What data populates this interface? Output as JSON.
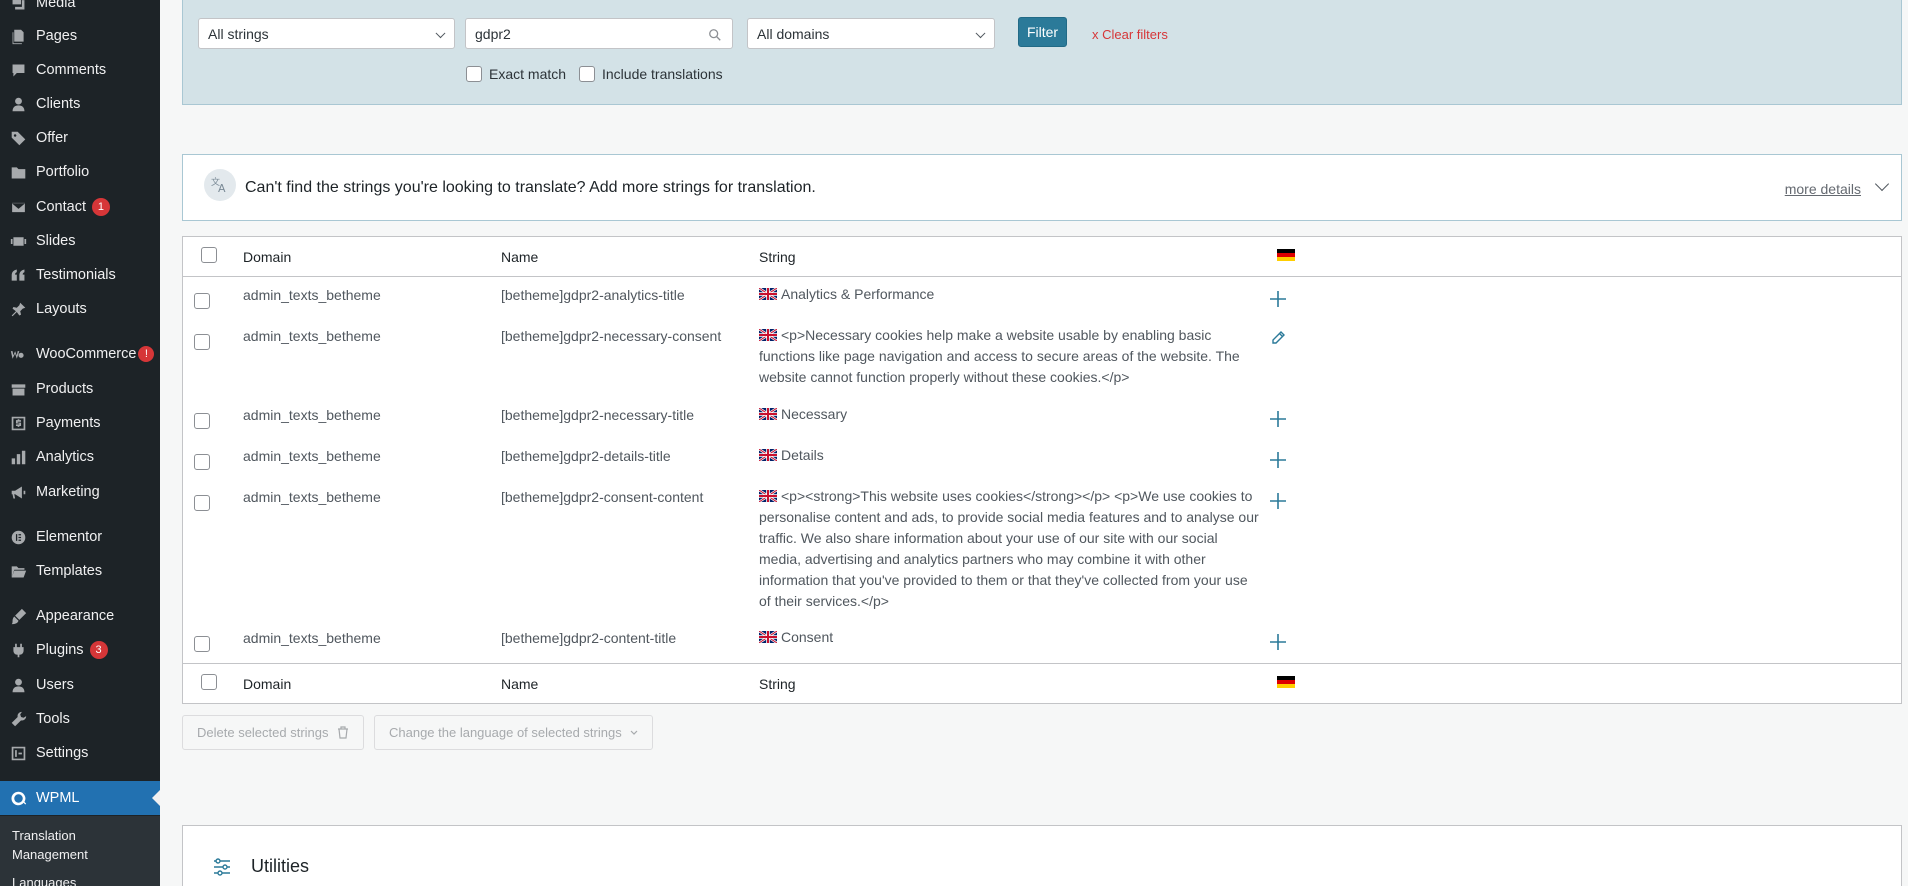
{
  "sidebar": {
    "items": [
      {
        "label": "Media",
        "icon": "media-icon"
      },
      {
        "label": "Pages",
        "icon": "pages-icon"
      },
      {
        "label": "Comments",
        "icon": "comments-icon"
      },
      {
        "label": "Clients",
        "icon": "clients-icon"
      },
      {
        "label": "Offer",
        "icon": "tag-icon"
      },
      {
        "label": "Portfolio",
        "icon": "folder-icon"
      },
      {
        "label": "Contact",
        "icon": "mail-icon",
        "badge": "1"
      },
      {
        "label": "Slides",
        "icon": "slides-icon"
      },
      {
        "label": "Testimonials",
        "icon": "quote-icon"
      },
      {
        "label": "Layouts",
        "icon": "pin-icon"
      },
      {
        "label": "WooCommerce",
        "icon": "woocommerce-icon",
        "badge": "!"
      },
      {
        "label": "Products",
        "icon": "archive-icon"
      },
      {
        "label": "Payments",
        "icon": "dollar-icon"
      },
      {
        "label": "Analytics",
        "icon": "bar-chart-icon"
      },
      {
        "label": "Marketing",
        "icon": "megaphone-icon"
      },
      {
        "label": "Elementor",
        "icon": "elementor-icon"
      },
      {
        "label": "Templates",
        "icon": "folder-open-icon"
      },
      {
        "label": "Appearance",
        "icon": "brush-icon"
      },
      {
        "label": "Plugins",
        "icon": "plug-icon",
        "badge": "3"
      },
      {
        "label": "Users",
        "icon": "users-icon"
      },
      {
        "label": "Tools",
        "icon": "wrench-icon"
      },
      {
        "label": "Settings",
        "icon": "settings-icon"
      },
      {
        "label": "WPML",
        "icon": "wpml-icon",
        "active": true
      }
    ],
    "submenu": {
      "translation_management": "Translation\nManagement",
      "languages": "Languages"
    }
  },
  "filters": {
    "type_select": "All strings",
    "search_value": "gdpr2",
    "domain_select": "All domains",
    "filter_button": "Filter",
    "clear_filters": "x  Clear filters",
    "exact_match": "Exact match",
    "include_translations": "Include translations"
  },
  "notice": {
    "text": "Can't find the strings you're looking to translate? Add more strings for translation.",
    "more_details": "more details"
  },
  "table": {
    "headers": {
      "domain": "Domain",
      "name": "Name",
      "string": "String"
    },
    "rows": [
      {
        "domain": "admin_texts_betheme",
        "name": "[betheme]gdpr2-analytics-title",
        "string": "Analytics & Performance",
        "action": "add"
      },
      {
        "domain": "admin_texts_betheme",
        "name": "[betheme]gdpr2-necessary-consent",
        "string": "<p>Necessary cookies help make a website usable by enabling basic functions like page navigation and access to secure areas of the website. The website cannot function properly without these cookies.</p>",
        "action": "edit"
      },
      {
        "domain": "admin_texts_betheme",
        "name": "[betheme]gdpr2-necessary-title",
        "string": "Necessary",
        "action": "add"
      },
      {
        "domain": "admin_texts_betheme",
        "name": "[betheme]gdpr2-details-title",
        "string": "Details",
        "action": "add"
      },
      {
        "domain": "admin_texts_betheme",
        "name": "[betheme]gdpr2-consent-content",
        "string": "<p><strong>This website uses cookies</strong></p> <p>We use cookies to personalise content and ads, to provide social media features and to analyse our traffic. We also share information about your use of our site with our social media, advertising and analytics partners who may combine it with other information that you've provided to them or that they've collected from your use of their services.</p>",
        "action": "add"
      },
      {
        "domain": "admin_texts_betheme",
        "name": "[betheme]gdpr2-content-title",
        "string": "Consent",
        "action": "add"
      }
    ]
  },
  "bulk": {
    "delete_label": "Delete selected strings",
    "change_language_label": "Change the language of selected strings"
  },
  "utilities": {
    "title": "Utilities"
  },
  "colors": {
    "accent": "#2271b1",
    "filter_bg": "#d3e2e7",
    "filter_button": "#2b7a99",
    "danger": "#d63638"
  }
}
